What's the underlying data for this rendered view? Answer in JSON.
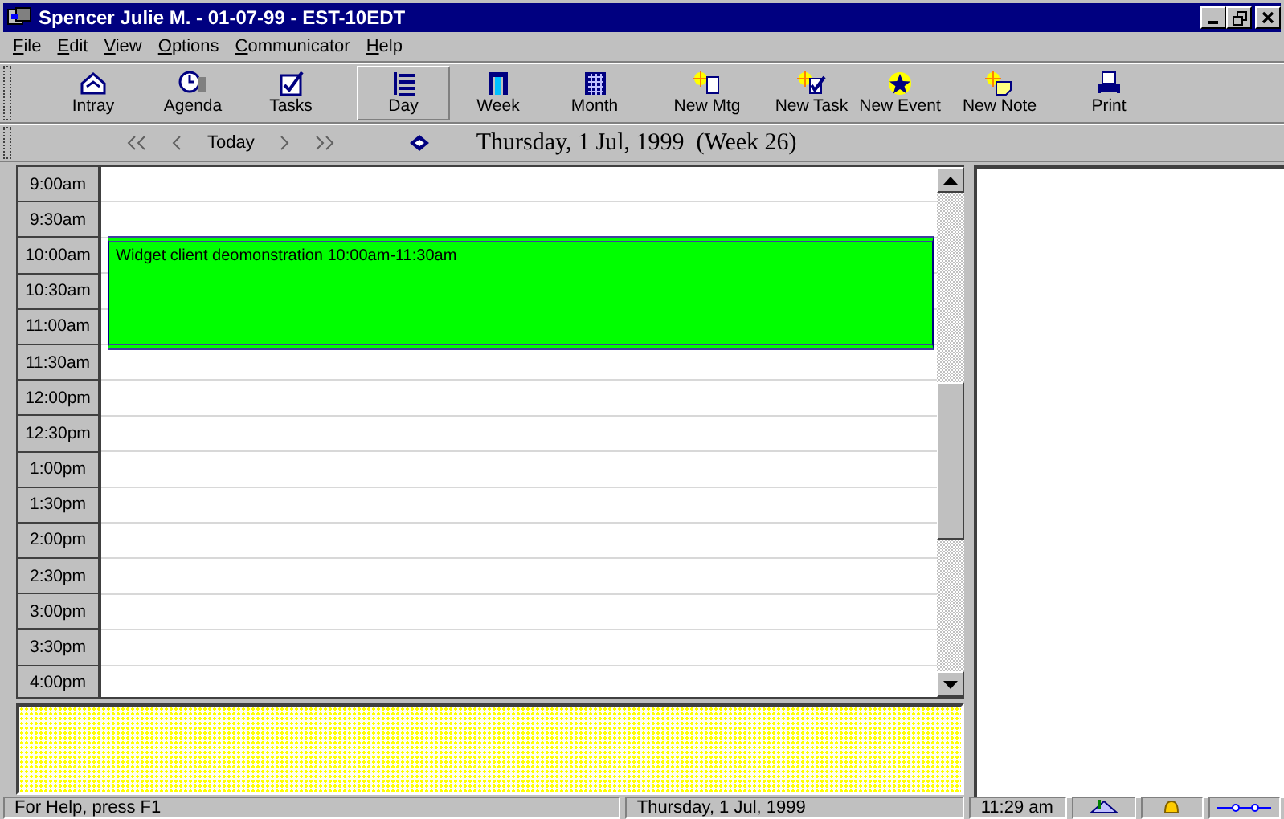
{
  "window": {
    "title": "Spencer Julie M. - 01-07-99 - EST-10EDT"
  },
  "menu": [
    "File",
    "Edit",
    "View",
    "Options",
    "Communicator",
    "Help"
  ],
  "toolbar": [
    {
      "label": "Intray",
      "selected": false
    },
    {
      "label": "Agenda",
      "selected": false
    },
    {
      "label": "Tasks",
      "selected": false
    },
    {
      "label": "Day",
      "selected": true
    },
    {
      "label": "Week",
      "selected": false
    },
    {
      "label": "Month",
      "selected": false
    },
    {
      "label": "New Mtg",
      "selected": false
    },
    {
      "label": "New Task",
      "selected": false
    },
    {
      "label": "New Event",
      "selected": false
    },
    {
      "label": "New Note",
      "selected": false
    },
    {
      "label": "Print",
      "selected": false
    }
  ],
  "navigation": {
    "today": "Today",
    "date": "Thursday, 1 Jul, 1999  (Week 26)"
  },
  "time_slots": [
    "9:00am",
    "9:30am",
    "10:00am",
    "10:30am",
    "11:00am",
    "11:30am",
    "12:00pm",
    "12:30pm",
    "1:00pm",
    "1:30pm",
    "2:00pm",
    "2:30pm",
    "3:00pm",
    "3:30pm",
    "4:00pm"
  ],
  "event": {
    "text": "Widget client deomonstration 10:00am-11:30am",
    "color": "#00ff00"
  },
  "status_bar": {
    "help": "For Help, press F1",
    "date": "Thursday, 1 Jul, 1999",
    "time": "11:29 am"
  }
}
